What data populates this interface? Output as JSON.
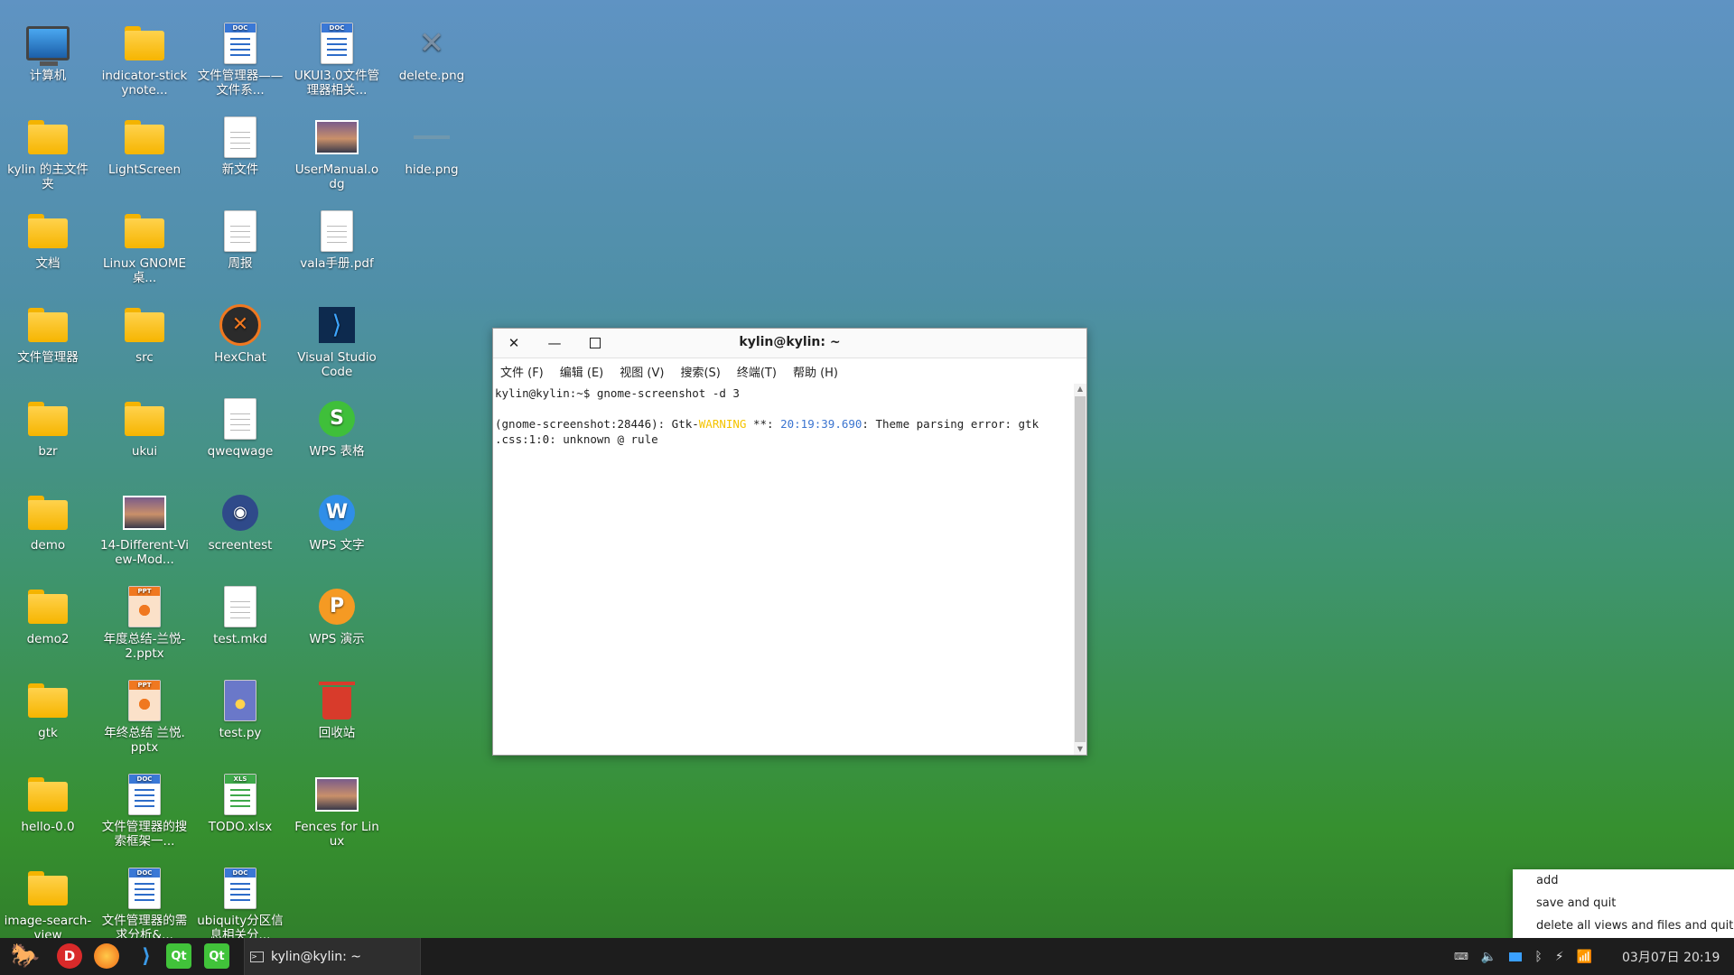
{
  "desktop_icons": [
    {
      "id": "computer",
      "label": "计算机",
      "kind": "monitor"
    },
    {
      "id": "indicator-stickynotes",
      "label": "indicator-stickynote...",
      "kind": "folder"
    },
    {
      "id": "fm-doc1",
      "label": "文件管理器——文件系...",
      "kind": "doc"
    },
    {
      "id": "ukui-doc",
      "label": "UKUI3.0文件管理器相关...",
      "kind": "doc"
    },
    {
      "id": "delete-png",
      "label": "delete.png",
      "kind": "x"
    },
    {
      "id": "kylin-home",
      "label": "kylin 的主文件夹",
      "kind": "folder"
    },
    {
      "id": "lightscreen",
      "label": "LightScreen",
      "kind": "folder"
    },
    {
      "id": "new-file",
      "label": "新文件",
      "kind": "plain"
    },
    {
      "id": "usermanual",
      "label": "UserManual.odg",
      "kind": "photo"
    },
    {
      "id": "hide-png",
      "label": "hide.png",
      "kind": "blank"
    },
    {
      "id": "docs",
      "label": "文档",
      "kind": "folder"
    },
    {
      "id": "linux-gnome",
      "label": "Linux GNOME桌...",
      "kind": "folder"
    },
    {
      "id": "weekly",
      "label": "周报",
      "kind": "plain"
    },
    {
      "id": "vala-pdf",
      "label": "vala手册.pdf",
      "kind": "plain"
    },
    {
      "id": "file-manager",
      "label": "文件管理器",
      "kind": "folder"
    },
    {
      "id": "src",
      "label": "src",
      "kind": "folder"
    },
    {
      "id": "hexchat",
      "label": "HexChat",
      "kind": "hexchat"
    },
    {
      "id": "vscode",
      "label": "Visual Studio Code",
      "kind": "vscode"
    },
    {
      "id": "bzr",
      "label": "bzr",
      "kind": "folder"
    },
    {
      "id": "ukui",
      "label": "ukui",
      "kind": "folder"
    },
    {
      "id": "qweqwage",
      "label": "qweqwage",
      "kind": "plain"
    },
    {
      "id": "wps-sheet",
      "label": "WPS 表格",
      "kind": "wps-s"
    },
    {
      "id": "demo",
      "label": "demo",
      "kind": "folder"
    },
    {
      "id": "14-different",
      "label": "14-Different-View-Mod...",
      "kind": "photo"
    },
    {
      "id": "screentest",
      "label": "screentest",
      "kind": "camera"
    },
    {
      "id": "wps-writer",
      "label": "WPS 文字",
      "kind": "wps-w"
    },
    {
      "id": "demo2",
      "label": "demo2",
      "kind": "folder"
    },
    {
      "id": "annual-ppt2",
      "label": "年度总结-兰悦-2.pptx",
      "kind": "ppt"
    },
    {
      "id": "test-mkd",
      "label": "test.mkd",
      "kind": "plain"
    },
    {
      "id": "wps-present",
      "label": "WPS 演示",
      "kind": "wps-p"
    },
    {
      "id": "gtk",
      "label": "gtk",
      "kind": "folder"
    },
    {
      "id": "yearend-ppt",
      "label": "年终总结 兰悦.pptx",
      "kind": "ppt"
    },
    {
      "id": "test-py",
      "label": "test.py",
      "kind": "python"
    },
    {
      "id": "trash",
      "label": "回收站",
      "kind": "trash"
    },
    {
      "id": "hello",
      "label": "hello-0.0",
      "kind": "folder"
    },
    {
      "id": "fm-search-doc",
      "label": "文件管理器的搜索框架一...",
      "kind": "doc"
    },
    {
      "id": "todo-xlsx",
      "label": "TODO.xlsx",
      "kind": "xls"
    },
    {
      "id": "fences",
      "label": "Fences for Linux",
      "kind": "photo"
    },
    {
      "id": "image-search-view",
      "label": "image-search-view",
      "kind": "folder"
    },
    {
      "id": "fm-req-doc",
      "label": "文件管理器的需求分析&...",
      "kind": "doc"
    },
    {
      "id": "ubiquity-doc",
      "label": "ubiquity分区信息相关分...",
      "kind": "doc"
    }
  ],
  "terminal": {
    "title": "kylin@kylin: ~",
    "menu": [
      "文件 (F)",
      "编辑 (E)",
      "视图 (V)",
      "搜索(S)",
      "终端(T)",
      "帮助 (H)"
    ],
    "prompt_line": "kylin@kylin:~$ gnome-screenshot -d 3",
    "line2_a": "(gnome-screenshot:28446): Gtk-",
    "line2_warn": "WARNING",
    "line2_b": " **: ",
    "line2_ts": "20:19:39.690",
    "line2_c": ": Theme parsing error: gtk",
    "line3": ".css:1:0: unknown @ rule"
  },
  "context_menu": [
    "add",
    "save and quit",
    "delete all views and files and quit"
  ],
  "taskbar": {
    "apps": [
      "kylin-logo",
      "D",
      "firefox",
      "vscode",
      "Qt",
      "Qt"
    ],
    "task_label": "kylin@kylin: ~",
    "clock": "03月07日 20:19"
  }
}
